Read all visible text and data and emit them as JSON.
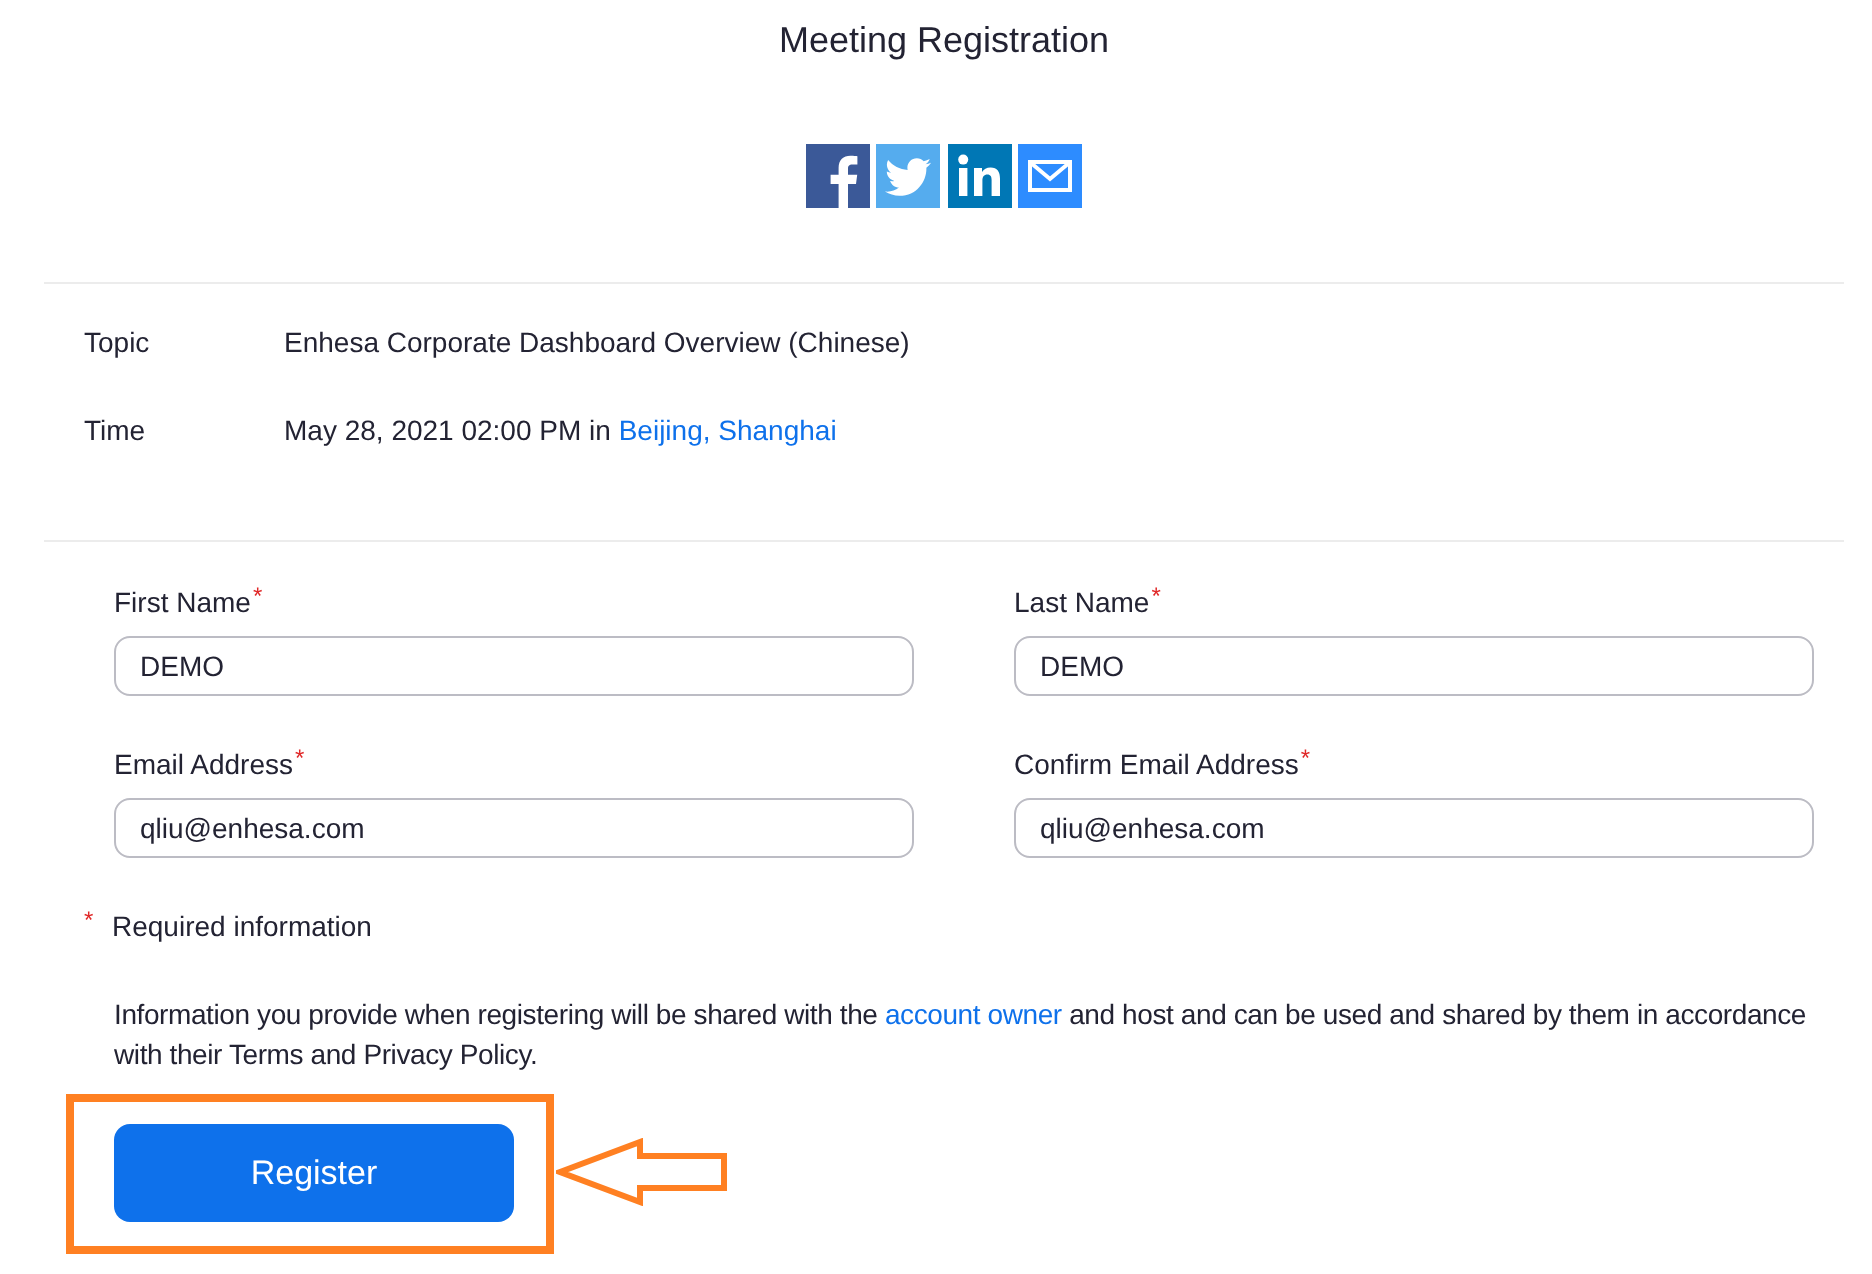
{
  "page": {
    "title": "Meeting Registration"
  },
  "share_buttons": [
    {
      "kind": "facebook"
    },
    {
      "kind": "twitter"
    },
    {
      "kind": "linkedin"
    },
    {
      "kind": "email"
    }
  ],
  "details": [
    {
      "label": "Topic",
      "value": "Enhesa Corporate Dashboard Overview (Chinese)"
    },
    {
      "label": "Time",
      "value": "May 28, 2021 02:00 PM in",
      "link": "Beijing, Shanghai"
    }
  ],
  "form": {
    "fields": [
      {
        "label": "First Name",
        "mark": "*",
        "value": "DEMO"
      },
      {
        "label": "Last Name",
        "mark": "*",
        "value": "DEMO"
      },
      {
        "label": "Email Address",
        "mark": "*",
        "value": "qliu@enhesa.com"
      },
      {
        "label": "Confirm Email Address",
        "mark": "*",
        "value": "qliu@enhesa.com"
      }
    ],
    "required_note": {
      "mark": "*",
      "text": "Required information"
    },
    "notice": {
      "before": "Information you provide when registering will be shared with the",
      "link": "account owner",
      "after": "and host and can be used and shared by them in accordance with their Terms and Privacy Policy."
    },
    "register_button": {
      "label": "Register",
      "highlighted": true
    }
  }
}
